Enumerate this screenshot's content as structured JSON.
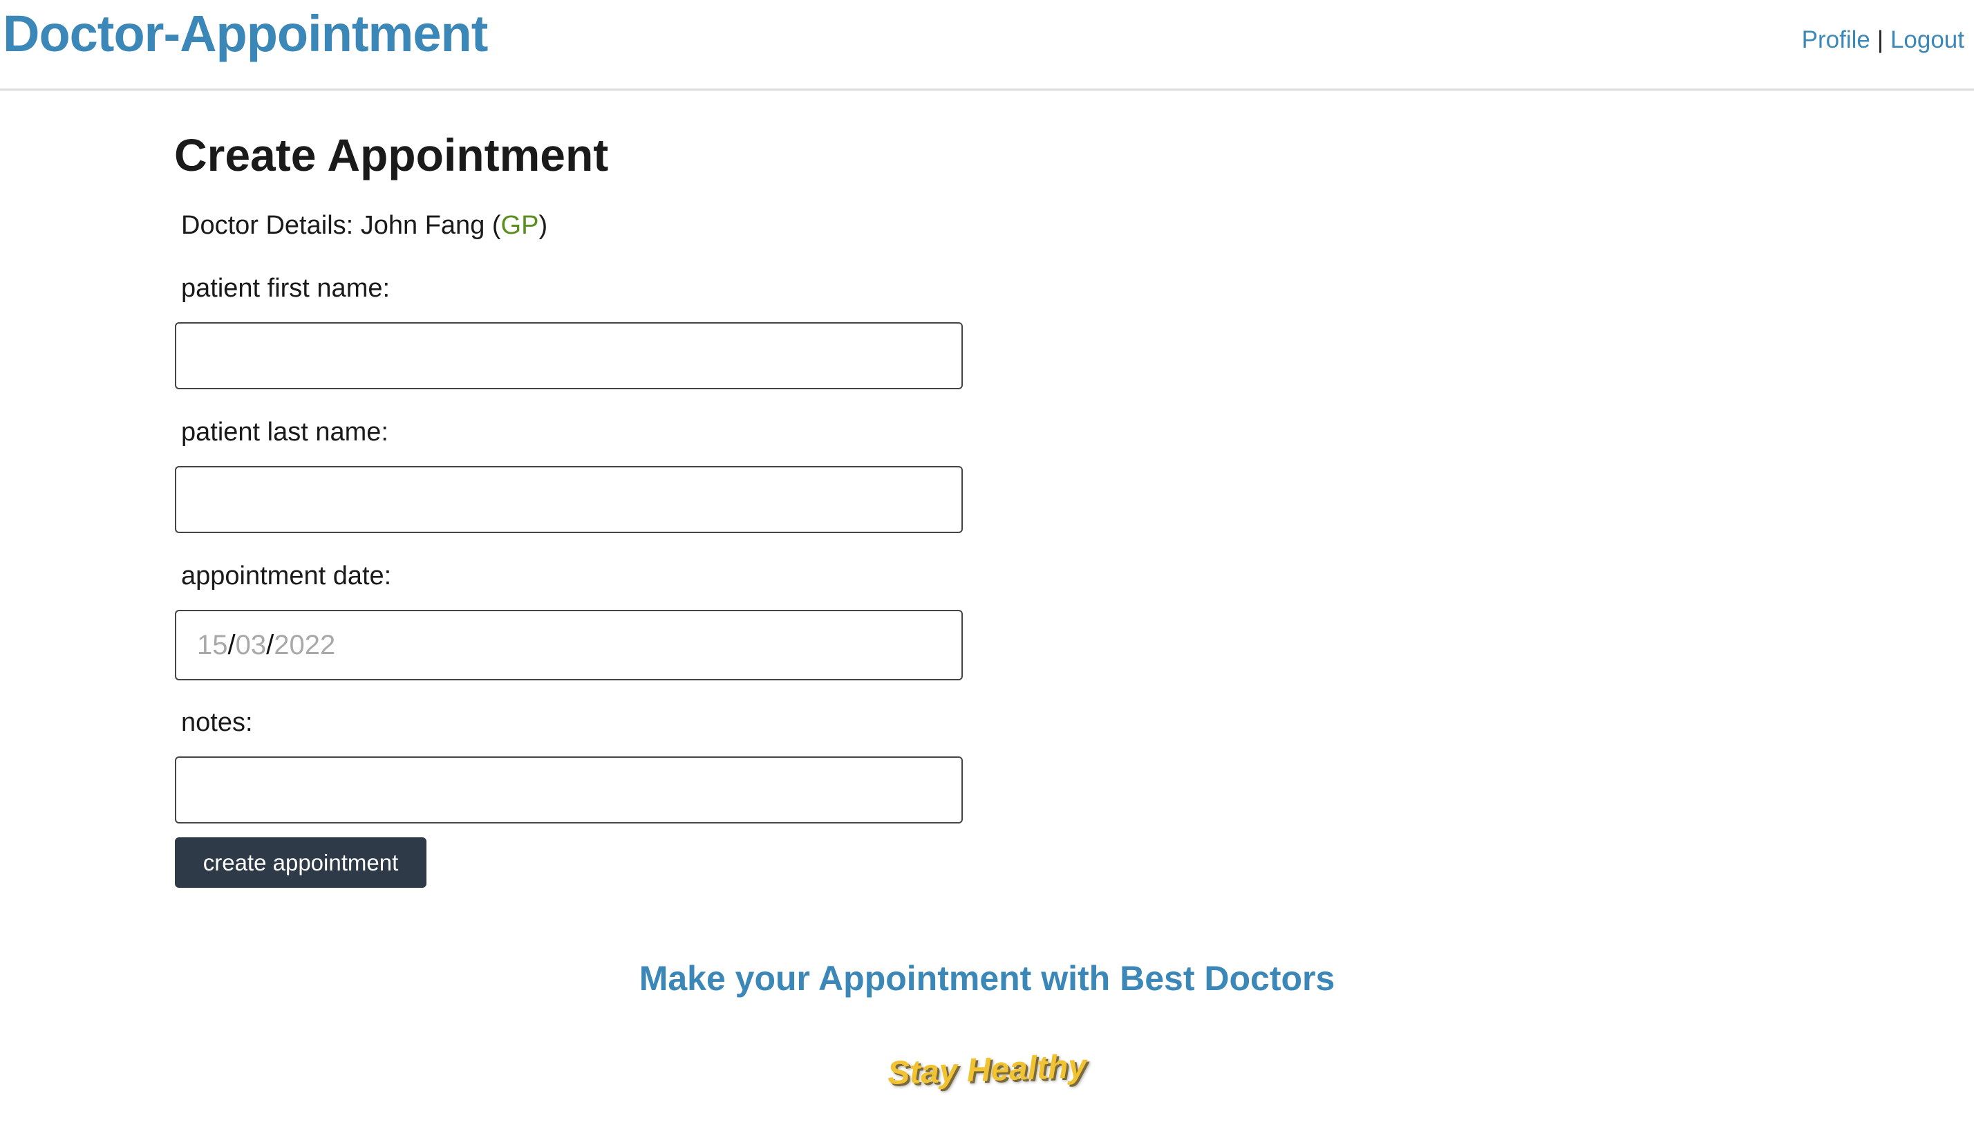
{
  "header": {
    "brand": "Doctor-Appointment",
    "nav": {
      "profile": "Profile",
      "separator": "|",
      "logout": "Logout"
    }
  },
  "main": {
    "title": "Create Appointment",
    "doctor": {
      "prefix": "Doctor Details: ",
      "name": "John Fang",
      "open_paren": " (",
      "specialty": "GP",
      "close_paren": ")"
    },
    "form": {
      "first_name_label": "patient first name:",
      "first_name_value": "",
      "last_name_label": "patient last name:",
      "last_name_value": "",
      "date_label": "appointment date:",
      "date": {
        "day": "15",
        "month": "03",
        "year": "2022",
        "separator": "/"
      },
      "notes_label": "notes:",
      "notes_value": "",
      "submit_label": "create appointment"
    }
  },
  "footer": {
    "tagline": "Make your Appointment with Best Doctors",
    "slogan": "Stay Healthy"
  },
  "colors": {
    "brand": "#3b87b8",
    "specialty": "#5a8f1e",
    "button": "#2e3a48",
    "slogan": "#f1c232"
  }
}
